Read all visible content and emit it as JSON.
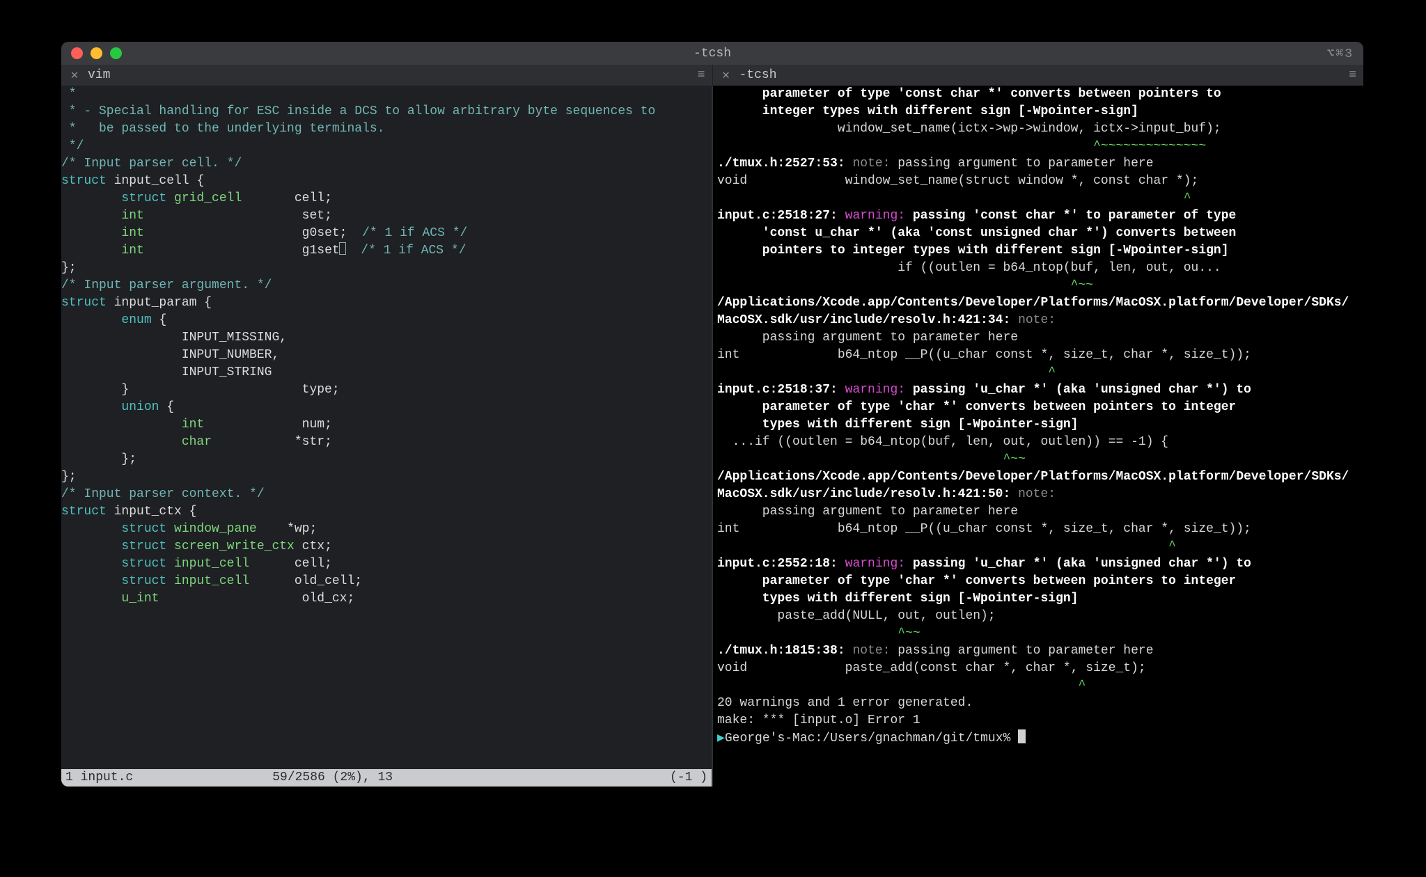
{
  "window": {
    "title": "-tcsh",
    "titlebar_right": "⌥⌘3"
  },
  "tabs": {
    "left": {
      "label": "vim",
      "close": "✕",
      "menu": "≡"
    },
    "right": {
      "label": "-tcsh",
      "close": "✕",
      "menu": "≡"
    }
  },
  "editor": {
    "lines": [
      {
        "segs": [
          {
            "t": " *",
            "cls": "c-comment"
          }
        ]
      },
      {
        "segs": [
          {
            "t": " * - Special handling for ESC inside a DCS to allow arbitrary byte sequences to",
            "cls": "c-comment"
          }
        ]
      },
      {
        "segs": [
          {
            "t": " *   be passed to the underlying terminals.",
            "cls": "c-comment"
          }
        ]
      },
      {
        "segs": [
          {
            "t": " */",
            "cls": "c-comment"
          }
        ]
      },
      {
        "segs": [
          {
            "t": ""
          }
        ]
      },
      {
        "segs": [
          {
            "t": "/* Input parser cell. */",
            "cls": "c-comment"
          }
        ]
      },
      {
        "segs": [
          {
            "t": "struct ",
            "cls": "c-keyword"
          },
          {
            "t": "input_cell {",
            "cls": "c-ident"
          }
        ]
      },
      {
        "segs": [
          {
            "t": "        struct ",
            "cls": "c-keyword"
          },
          {
            "t": "grid_cell",
            "cls": "c-type"
          },
          {
            "t": "       cell;",
            "cls": "c-ident"
          }
        ]
      },
      {
        "segs": [
          {
            "t": "        int",
            "cls": "c-type"
          },
          {
            "t": "                     set;",
            "cls": "c-ident"
          }
        ]
      },
      {
        "segs": [
          {
            "t": "        int",
            "cls": "c-type"
          },
          {
            "t": "                     g0set;  ",
            "cls": "c-ident"
          },
          {
            "t": "/* 1 if ACS */",
            "cls": "c-comment"
          }
        ]
      },
      {
        "segs": [
          {
            "t": "        int",
            "cls": "c-type"
          },
          {
            "t": "                     g1set",
            "cls": "c-ident"
          },
          {
            "t": "",
            "cursor": true
          },
          {
            "t": "  /* 1 if ACS */",
            "cls": "c-comment"
          }
        ]
      },
      {
        "segs": [
          {
            "t": "};",
            "cls": "c-ident"
          }
        ]
      },
      {
        "segs": [
          {
            "t": ""
          }
        ]
      },
      {
        "segs": [
          {
            "t": "/* Input parser argument. */",
            "cls": "c-comment"
          }
        ]
      },
      {
        "segs": [
          {
            "t": "struct ",
            "cls": "c-keyword"
          },
          {
            "t": "input_param {",
            "cls": "c-ident"
          }
        ]
      },
      {
        "segs": [
          {
            "t": "        enum ",
            "cls": "c-keyword"
          },
          {
            "t": "{",
            "cls": "c-ident"
          }
        ]
      },
      {
        "segs": [
          {
            "t": "                INPUT_MISSING,",
            "cls": "c-ident"
          }
        ]
      },
      {
        "segs": [
          {
            "t": "                INPUT_NUMBER,",
            "cls": "c-ident"
          }
        ]
      },
      {
        "segs": [
          {
            "t": "                INPUT_STRING",
            "cls": "c-ident"
          }
        ]
      },
      {
        "segs": [
          {
            "t": "        }                       type;",
            "cls": "c-ident"
          }
        ]
      },
      {
        "segs": [
          {
            "t": "        union ",
            "cls": "c-keyword"
          },
          {
            "t": "{",
            "cls": "c-ident"
          }
        ]
      },
      {
        "segs": [
          {
            "t": "                int",
            "cls": "c-type"
          },
          {
            "t": "             num;",
            "cls": "c-ident"
          }
        ]
      },
      {
        "segs": [
          {
            "t": "                char",
            "cls": "c-type"
          },
          {
            "t": "           *str;",
            "cls": "c-ident"
          }
        ]
      },
      {
        "segs": [
          {
            "t": "        };",
            "cls": "c-ident"
          }
        ]
      },
      {
        "segs": [
          {
            "t": "};",
            "cls": "c-ident"
          }
        ]
      },
      {
        "segs": [
          {
            "t": ""
          }
        ]
      },
      {
        "segs": [
          {
            "t": "/* Input parser context. */",
            "cls": "c-comment"
          }
        ]
      },
      {
        "segs": [
          {
            "t": "struct ",
            "cls": "c-keyword"
          },
          {
            "t": "input_ctx {",
            "cls": "c-ident"
          }
        ]
      },
      {
        "segs": [
          {
            "t": "        struct ",
            "cls": "c-keyword"
          },
          {
            "t": "window_pane",
            "cls": "c-type"
          },
          {
            "t": "    *wp;",
            "cls": "c-ident"
          }
        ]
      },
      {
        "segs": [
          {
            "t": "        struct ",
            "cls": "c-keyword"
          },
          {
            "t": "screen_write_ctx",
            "cls": "c-type"
          },
          {
            "t": " ctx;",
            "cls": "c-ident"
          }
        ]
      },
      {
        "segs": [
          {
            "t": ""
          }
        ]
      },
      {
        "segs": [
          {
            "t": "        struct ",
            "cls": "c-keyword"
          },
          {
            "t": "input_cell",
            "cls": "c-type"
          },
          {
            "t": "      cell;",
            "cls": "c-ident"
          }
        ]
      },
      {
        "segs": [
          {
            "t": ""
          }
        ]
      },
      {
        "segs": [
          {
            "t": "        struct ",
            "cls": "c-keyword"
          },
          {
            "t": "input_cell",
            "cls": "c-type"
          },
          {
            "t": "      old_cell;",
            "cls": "c-ident"
          }
        ]
      },
      {
        "segs": [
          {
            "t": "        u_int",
            "cls": "c-type"
          },
          {
            "t": "                   old_cx;",
            "cls": "c-ident"
          }
        ]
      }
    ],
    "status": {
      "left": "1 input.c",
      "mid": "59/2586 (2%), 13",
      "right": "(-1 )"
    }
  },
  "compiler": {
    "lines": [
      {
        "segs": [
          {
            "t": "      parameter of type 'const char *' converts between pointers to",
            "cls": "w-white"
          }
        ]
      },
      {
        "segs": [
          {
            "t": "      integer types with different sign [-Wpointer-sign]",
            "cls": "w-white"
          }
        ]
      },
      {
        "segs": [
          {
            "t": "                window_set_name(ictx->wp->window, ictx->input_buf);",
            "cls": "w-dim"
          }
        ]
      },
      {
        "segs": [
          {
            "t": "                                                  ^~~~~~~~~~~~~~~",
            "cls": "w-green"
          }
        ]
      },
      {
        "segs": [
          {
            "t": "./tmux.h:2527:53: ",
            "cls": "w-white"
          },
          {
            "t": "note:",
            "cls": "tag-note"
          },
          {
            "t": " passing argument to parameter here",
            "cls": "w-dim"
          }
        ]
      },
      {
        "segs": [
          {
            "t": "void",
            "cls": "w-dim"
          },
          {
            "t": "             window_set_name(struct window *, const char *);",
            "cls": "w-dim"
          }
        ]
      },
      {
        "segs": [
          {
            "t": "                                                              ^",
            "cls": "w-green"
          }
        ]
      },
      {
        "segs": [
          {
            "t": "input.c:2518:27: ",
            "cls": "w-white"
          },
          {
            "t": "warning:",
            "cls": "tag-warning"
          },
          {
            "t": " passing 'const char *' to parameter of type",
            "cls": "w-white"
          }
        ]
      },
      {
        "segs": [
          {
            "t": "      'const u_char *' (aka 'const unsigned char *') converts between",
            "cls": "w-white"
          }
        ]
      },
      {
        "segs": [
          {
            "t": "      pointers to integer types with different sign [-Wpointer-sign]",
            "cls": "w-white"
          }
        ]
      },
      {
        "segs": [
          {
            "t": "                        if ((outlen = b64_ntop(buf, len, out, ou...",
            "cls": "w-dim"
          }
        ]
      },
      {
        "segs": [
          {
            "t": "                                               ^~~",
            "cls": "w-green"
          }
        ]
      },
      {
        "segs": [
          {
            "t": "/Applications/Xcode.app/Contents/Developer/Platforms/MacOSX.platform/Developer/SDKs/",
            "cls": "w-white"
          }
        ]
      },
      {
        "segs": [
          {
            "t": "MacOSX.sdk/usr/include/resolv.h:421:34: ",
            "cls": "w-white"
          },
          {
            "t": "note:",
            "cls": "tag-note"
          },
          {
            "t": " ",
            "cls": "w-dim"
          }
        ]
      },
      {
        "segs": [
          {
            "t": "      passing argument to parameter here",
            "cls": "w-dim"
          }
        ]
      },
      {
        "segs": [
          {
            "t": "int",
            "cls": "w-dim"
          },
          {
            "t": "             b64_ntop __P((u_char const *, size_t, char *, size_t));",
            "cls": "w-dim"
          }
        ]
      },
      {
        "segs": [
          {
            "t": "                                            ^",
            "cls": "w-green"
          }
        ]
      },
      {
        "segs": [
          {
            "t": "input.c:2518:37: ",
            "cls": "w-white"
          },
          {
            "t": "warning:",
            "cls": "tag-warning"
          },
          {
            "t": " passing 'u_char *' (aka 'unsigned char *') to",
            "cls": "w-white"
          }
        ]
      },
      {
        "segs": [
          {
            "t": "      parameter of type 'char *' converts between pointers to integer",
            "cls": "w-white"
          }
        ]
      },
      {
        "segs": [
          {
            "t": "      types with different sign [-Wpointer-sign]",
            "cls": "w-white"
          }
        ]
      },
      {
        "segs": [
          {
            "t": "  ...if ((outlen = b64_ntop(buf, len, out, outlen)) == -1) {",
            "cls": "w-dim"
          }
        ]
      },
      {
        "segs": [
          {
            "t": "                                      ^~~",
            "cls": "w-green"
          }
        ]
      },
      {
        "segs": [
          {
            "t": "/Applications/Xcode.app/Contents/Developer/Platforms/MacOSX.platform/Developer/SDKs/",
            "cls": "w-white"
          }
        ]
      },
      {
        "segs": [
          {
            "t": "MacOSX.sdk/usr/include/resolv.h:421:50: ",
            "cls": "w-white"
          },
          {
            "t": "note:",
            "cls": "tag-note"
          },
          {
            "t": " ",
            "cls": "w-dim"
          }
        ]
      },
      {
        "segs": [
          {
            "t": "      passing argument to parameter here",
            "cls": "w-dim"
          }
        ]
      },
      {
        "segs": [
          {
            "t": "int",
            "cls": "w-dim"
          },
          {
            "t": "             b64_ntop __P((u_char const *, size_t, char *, size_t));",
            "cls": "w-dim"
          }
        ]
      },
      {
        "segs": [
          {
            "t": "                                                            ^",
            "cls": "w-green"
          }
        ]
      },
      {
        "segs": [
          {
            "t": "input.c:2552:18: ",
            "cls": "w-white"
          },
          {
            "t": "warning:",
            "cls": "tag-warning"
          },
          {
            "t": " passing 'u_char *' (aka 'unsigned char *') to",
            "cls": "w-white"
          }
        ]
      },
      {
        "segs": [
          {
            "t": "      parameter of type 'char *' converts between pointers to integer",
            "cls": "w-white"
          }
        ]
      },
      {
        "segs": [
          {
            "t": "      types with different sign [-Wpointer-sign]",
            "cls": "w-white"
          }
        ]
      },
      {
        "segs": [
          {
            "t": "        paste_add(NULL, out, outlen);",
            "cls": "w-dim"
          }
        ]
      },
      {
        "segs": [
          {
            "t": "                        ^~~",
            "cls": "w-green"
          }
        ]
      },
      {
        "segs": [
          {
            "t": "./tmux.h:1815:38: ",
            "cls": "w-white"
          },
          {
            "t": "note:",
            "cls": "tag-note"
          },
          {
            "t": " passing argument to parameter here",
            "cls": "w-dim"
          }
        ]
      },
      {
        "segs": [
          {
            "t": "void",
            "cls": "w-dim"
          },
          {
            "t": "             paste_add(const char *, char *, size_t);",
            "cls": "w-dim"
          }
        ]
      },
      {
        "segs": [
          {
            "t": "                                                ^",
            "cls": "w-green"
          }
        ]
      },
      {
        "segs": [
          {
            "t": "20 warnings and 1 error generated.",
            "cls": "w-dim"
          }
        ]
      },
      {
        "segs": [
          {
            "t": "make: *** [input.o] Error 1",
            "cls": "w-dim"
          }
        ]
      },
      {
        "segs": [
          {
            "t": "▶",
            "cls": "w-cyan"
          },
          {
            "t": "George's-Mac:/Users/gnachman/git/tmux% ",
            "cls": "w-dim"
          },
          {
            "cursor": true,
            "block": true
          }
        ]
      }
    ]
  }
}
